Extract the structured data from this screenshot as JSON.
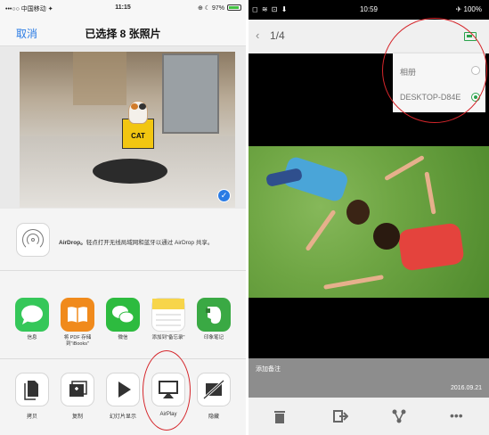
{
  "ios": {
    "status": {
      "carrier": "•••○○ 中国移动 ✦",
      "time": "11:15",
      "battery": "⊕ ☾ 97%"
    },
    "nav": {
      "cancel": "取消",
      "title": "已选择 8 张照片"
    },
    "photo": {
      "sign_text": "CAT",
      "selected_mark": "✓"
    },
    "airdrop": {
      "name": "AirDrop。",
      "desc": "轻点打开无线局域网和蓝牙以通过 AirDrop 共享。"
    },
    "apps": [
      {
        "label": "信息",
        "icon": "messages-icon",
        "color": "#35c759"
      },
      {
        "label": "将 PDF 存储到\"iBooks\"",
        "icon": "ibooks-icon",
        "color": "#f08a1c"
      },
      {
        "label": "微信",
        "icon": "wechat-icon",
        "color": "#2dbb3f"
      },
      {
        "label": "添加到\"备忘录\"",
        "icon": "notes-icon",
        "color": "#f7d54a"
      },
      {
        "label": "印象笔记",
        "icon": "evernote-icon",
        "color": "#3aa944"
      }
    ],
    "actions": [
      {
        "label": "拷贝",
        "icon": "copy-icon"
      },
      {
        "label": "复制",
        "icon": "duplicate-icon"
      },
      {
        "label": "幻灯片显示",
        "icon": "slideshow-icon"
      },
      {
        "label": "AirPlay",
        "icon": "airplay-icon"
      },
      {
        "label": "隐藏",
        "icon": "hide-icon"
      }
    ]
  },
  "android": {
    "status": {
      "left": "◻ ≋ ⊡ ⬇",
      "time": "10:59",
      "right": "✈ 100%"
    },
    "top": {
      "back": "‹",
      "counter": "1/4"
    },
    "menu": [
      {
        "label": "相册",
        "selected": false
      },
      {
        "label": "DESKTOP-D84E",
        "selected": true
      }
    ],
    "caption": {
      "note": "添加备注",
      "date": "2016.09.21"
    },
    "bottom_icons": [
      "trash-icon",
      "export-icon",
      "share-icon",
      "more-icon"
    ],
    "more_glyph": "•••"
  }
}
